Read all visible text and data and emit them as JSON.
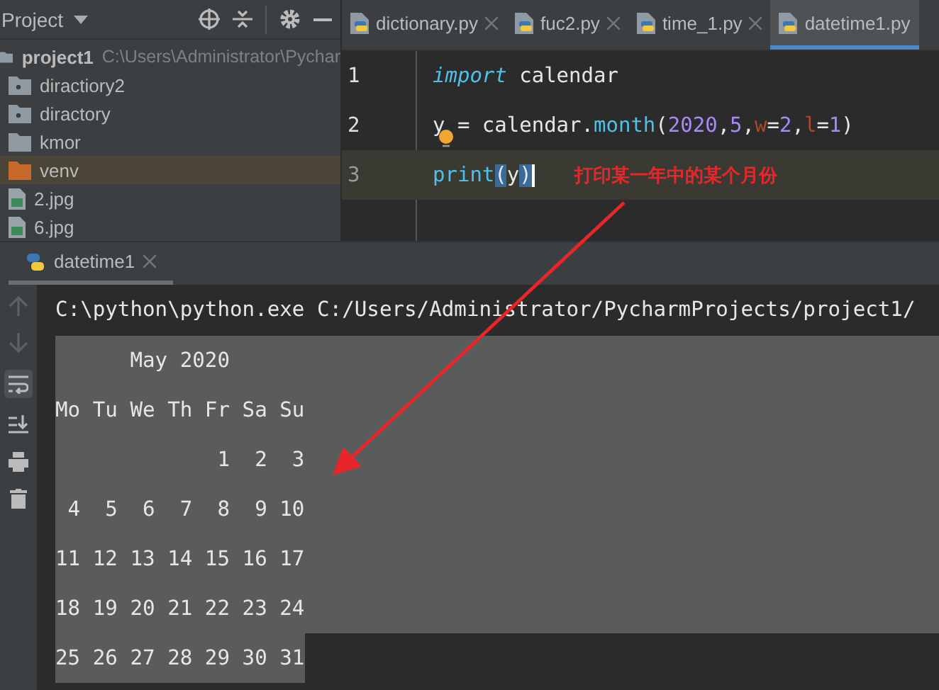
{
  "project_panel": {
    "title": "Project",
    "items": [
      {
        "name": "project1",
        "path": "C:\\Users\\Administrator\\Pychar",
        "kind": "root",
        "selected": false
      },
      {
        "name": "diractiory2",
        "kind": "package",
        "selected": false
      },
      {
        "name": "diractory",
        "kind": "package",
        "selected": false
      },
      {
        "name": "kmor",
        "kind": "folder",
        "selected": false
      },
      {
        "name": "venv",
        "kind": "excluded-folder",
        "selected": true
      },
      {
        "name": "2.jpg",
        "kind": "image",
        "selected": false
      },
      {
        "name": "6.jpg",
        "kind": "image",
        "selected": false
      }
    ]
  },
  "editor": {
    "tabs": [
      {
        "label": "dictionary.py",
        "selected": false
      },
      {
        "label": "fuc2.py",
        "selected": false
      },
      {
        "label": "time_1.py",
        "selected": false
      },
      {
        "label": "datetime1.py",
        "selected": true
      }
    ],
    "lines": [
      {
        "number": "1",
        "current": false,
        "tokens": [
          {
            "text": "import",
            "kind": "keyword"
          },
          {
            "text": " calendar",
            "kind": "plain"
          }
        ]
      },
      {
        "number": "2",
        "current": false,
        "tokens": [
          {
            "text": "y = calendar.",
            "kind": "plain"
          },
          {
            "text": "month",
            "kind": "call"
          },
          {
            "text": "(",
            "kind": "plain"
          },
          {
            "text": "2020",
            "kind": "number"
          },
          {
            "text": ",",
            "kind": "plain"
          },
          {
            "text": "5",
            "kind": "number"
          },
          {
            "text": ",",
            "kind": "plain"
          },
          {
            "text": "w",
            "kind": "param"
          },
          {
            "text": "=",
            "kind": "plain"
          },
          {
            "text": "2",
            "kind": "number"
          },
          {
            "text": ",",
            "kind": "plain"
          },
          {
            "text": "l",
            "kind": "param"
          },
          {
            "text": "=",
            "kind": "plain"
          },
          {
            "text": "1",
            "kind": "number"
          },
          {
            "text": ")",
            "kind": "plain"
          }
        ]
      },
      {
        "number": "3",
        "current": true,
        "tokens": [
          {
            "text": "print",
            "kind": "call"
          },
          {
            "text": "(",
            "kind": "brace"
          },
          {
            "text": "y",
            "kind": "plain"
          },
          {
            "text": ")",
            "kind": "brace"
          }
        ]
      }
    ],
    "annotation": "打印某一年中的某个月份"
  },
  "run_panel": {
    "tab": "datetime1",
    "command": "C:\\python\\python.exe C:/Users/Administrator/PycharmProjects/project1/",
    "output": [
      {
        "text": "      May 2020",
        "selected": true
      },
      {
        "text": "Mo Tu We Th Fr Sa Su",
        "selected": true
      },
      {
        "text": "             1  2  3",
        "selected": true
      },
      {
        "text": " 4  5  6  7  8  9 10",
        "selected": true
      },
      {
        "text": "11 12 13 14 15 16 17",
        "selected": true
      },
      {
        "text": "18 19 20 21 22 23 24",
        "selected": true
      },
      {
        "text": "25 26 27 28 29 30 31",
        "selected": true
      }
    ]
  }
}
